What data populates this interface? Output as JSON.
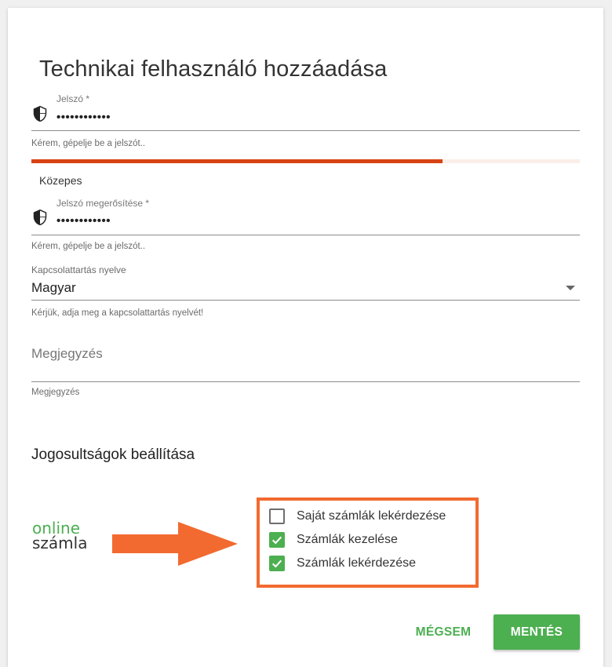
{
  "dialog": {
    "title": "Technikai felhasználó hozzáadása",
    "password": {
      "label": "Jelszó *",
      "value": "••••••••••••",
      "hint": "Kérem, gépelje be a jelszót..",
      "strength": {
        "level": 0.75,
        "text": "Közepes",
        "color": "#d84315"
      }
    },
    "password_confirm": {
      "label": "Jelszó megerősítése *",
      "value": "••••••••••••",
      "hint": "Kérem, gépelje be a jelszót.."
    },
    "language": {
      "label": "Kapcsolattartás nyelve",
      "value": "Magyar",
      "hint": "Kérjük, adja meg a kapcsolattartás nyelvét!"
    },
    "note": {
      "placeholder": "Megjegyzés",
      "hint": "Megjegyzés"
    },
    "permissions": {
      "title": "Jogosultságok beállítása",
      "items": [
        {
          "label": "Saját számlák lekérdezése",
          "checked": false
        },
        {
          "label": "Számlák kezelése",
          "checked": true
        },
        {
          "label": "Számlák lekérdezése",
          "checked": true
        }
      ]
    },
    "logo": {
      "line1": "online",
      "line2": "számla"
    },
    "buttons": {
      "cancel": "MÉGSEM",
      "save": "MENTÉS"
    },
    "colors": {
      "accent": "#4caf50",
      "highlight": "#f26a30",
      "logo_dark": "#333333"
    },
    "icons": {
      "password": "shield-icon",
      "password_confirm": "shield-icon",
      "language_dropdown": "caret-down-icon",
      "annotation": "arrow-right-icon"
    }
  }
}
